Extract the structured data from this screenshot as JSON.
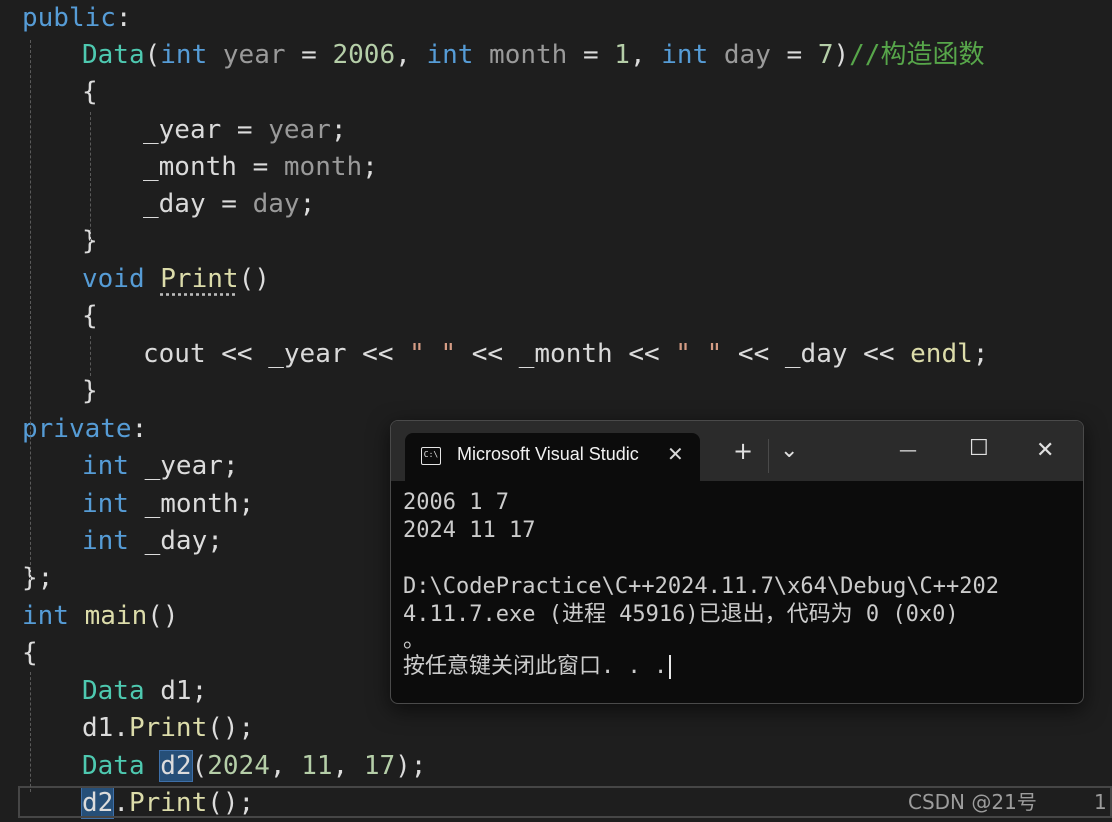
{
  "editor": {
    "lines": [
      {
        "tokens": [
          {
            "t": "public",
            "c": "kw"
          },
          {
            "t": ":",
            "c": ""
          }
        ]
      },
      {
        "tokens": [
          {
            "t": "Data",
            "c": "type"
          },
          {
            "t": "(",
            "c": ""
          },
          {
            "t": "int",
            "c": "kw"
          },
          {
            "t": " year",
            "c": "param"
          },
          {
            "t": " = ",
            "c": ""
          },
          {
            "t": "2006",
            "c": "num"
          },
          {
            "t": ", ",
            "c": ""
          },
          {
            "t": "int",
            "c": "kw"
          },
          {
            "t": " month",
            "c": "param"
          },
          {
            "t": " = ",
            "c": ""
          },
          {
            "t": "1",
            "c": "num"
          },
          {
            "t": ", ",
            "c": ""
          },
          {
            "t": "int",
            "c": "kw"
          },
          {
            "t": " day",
            "c": "param"
          },
          {
            "t": " = ",
            "c": ""
          },
          {
            "t": "7",
            "c": "num"
          },
          {
            "t": ")",
            "c": ""
          },
          {
            "t": "//构造函数",
            "c": "cmt"
          }
        ]
      },
      {
        "tokens": [
          {
            "t": "{",
            "c": ""
          }
        ]
      },
      {
        "tokens": [
          {
            "t": "_year",
            "c": "fld"
          },
          {
            "t": " = ",
            "c": ""
          },
          {
            "t": "year",
            "c": "param"
          },
          {
            "t": ";",
            "c": ""
          }
        ]
      },
      {
        "tokens": [
          {
            "t": "_month",
            "c": "fld"
          },
          {
            "t": " = ",
            "c": ""
          },
          {
            "t": "month",
            "c": "param"
          },
          {
            "t": ";",
            "c": ""
          }
        ]
      },
      {
        "tokens": [
          {
            "t": "_day",
            "c": "fld"
          },
          {
            "t": " = ",
            "c": ""
          },
          {
            "t": "day",
            "c": "param"
          },
          {
            "t": ";",
            "c": ""
          }
        ]
      },
      {
        "tokens": [
          {
            "t": "}",
            "c": ""
          }
        ]
      },
      {
        "tokens": [
          {
            "t": "void",
            "c": "kw"
          },
          {
            "t": " ",
            "c": ""
          },
          {
            "t": "Print",
            "c": "fn squiggle"
          },
          {
            "t": "()",
            "c": ""
          }
        ]
      },
      {
        "tokens": [
          {
            "t": "{",
            "c": ""
          }
        ]
      },
      {
        "tokens": [
          {
            "t": "cout",
            "c": "fld"
          },
          {
            "t": " << ",
            "c": ""
          },
          {
            "t": "_year",
            "c": "fld"
          },
          {
            "t": " << ",
            "c": ""
          },
          {
            "t": "\" \"",
            "c": "str"
          },
          {
            "t": " << ",
            "c": ""
          },
          {
            "t": "_month",
            "c": "fld"
          },
          {
            "t": " << ",
            "c": ""
          },
          {
            "t": "\" \"",
            "c": "str"
          },
          {
            "t": " << ",
            "c": ""
          },
          {
            "t": "_day",
            "c": "fld"
          },
          {
            "t": " << ",
            "c": ""
          },
          {
            "t": "endl",
            "c": "fn"
          },
          {
            "t": ";",
            "c": ""
          }
        ]
      },
      {
        "tokens": [
          {
            "t": "}",
            "c": ""
          }
        ]
      },
      {
        "tokens": [
          {
            "t": "private",
            "c": "kw"
          },
          {
            "t": ":",
            "c": ""
          }
        ]
      },
      {
        "tokens": [
          {
            "t": "int",
            "c": "kw"
          },
          {
            "t": " _year;",
            "c": ""
          }
        ]
      },
      {
        "tokens": [
          {
            "t": "int",
            "c": "kw"
          },
          {
            "t": " _month;",
            "c": ""
          }
        ]
      },
      {
        "tokens": [
          {
            "t": "int",
            "c": "kw"
          },
          {
            "t": " _day;",
            "c": ""
          }
        ]
      },
      {
        "tokens": [
          {
            "t": "};",
            "c": ""
          }
        ]
      },
      {
        "tokens": [
          {
            "t": "int",
            "c": "kw"
          },
          {
            "t": " ",
            "c": ""
          },
          {
            "t": "main",
            "c": "fn"
          },
          {
            "t": "()",
            "c": ""
          }
        ]
      },
      {
        "tokens": [
          {
            "t": "{",
            "c": ""
          }
        ]
      },
      {
        "tokens": [
          {
            "t": "Data",
            "c": "type"
          },
          {
            "t": " d1;",
            "c": ""
          }
        ]
      },
      {
        "tokens": [
          {
            "t": "d1.",
            "c": ""
          },
          {
            "t": "Print",
            "c": "fn"
          },
          {
            "t": "();",
            "c": ""
          }
        ]
      },
      {
        "tokens": [
          {
            "t": "Data",
            "c": "type"
          },
          {
            "t": " ",
            "c": ""
          },
          {
            "t": "d2",
            "c": "sel"
          },
          {
            "t": "(",
            "c": ""
          },
          {
            "t": "2024",
            "c": "num"
          },
          {
            "t": ", ",
            "c": ""
          },
          {
            "t": "11",
            "c": "num"
          },
          {
            "t": ", ",
            "c": ""
          },
          {
            "t": "17",
            "c": "num"
          },
          {
            "t": ");",
            "c": ""
          }
        ]
      },
      {
        "tokens": [
          {
            "t": "d2",
            "c": "sel"
          },
          {
            "t": ".",
            "c": ""
          },
          {
            "t": "Print",
            "c": "fn"
          },
          {
            "t": "();",
            "c": ""
          }
        ]
      }
    ],
    "watermark": "CSDN @21号",
    "line_indicator": "1"
  },
  "terminal": {
    "tab_icon_text": "C:\\",
    "tab_title": "Microsoft Visual Studic",
    "close_tab": "✕",
    "new_tab": "+",
    "dropdown": "⌄",
    "minimize": "—",
    "maximize": "☐",
    "close_window": "✕",
    "output": [
      "2006 1 7",
      "2024 11 17",
      "",
      "D:\\CodePractice\\C++2024.11.7\\x64\\Debug\\C++202",
      "4.11.7.exe (进程 45916)已退出，代码为 0 (0x0)",
      "。",
      "按任意键关闭此窗口. . ."
    ]
  }
}
